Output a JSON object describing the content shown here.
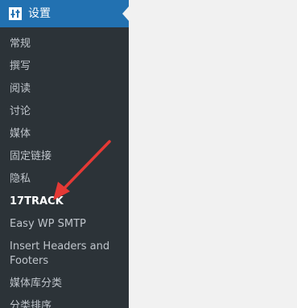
{
  "sidebar": {
    "header": {
      "title": "设置",
      "icon": "settings-sliders-icon"
    },
    "items": [
      {
        "label": "常规",
        "current": false
      },
      {
        "label": "撰写",
        "current": false
      },
      {
        "label": "阅读",
        "current": false
      },
      {
        "label": "讨论",
        "current": false
      },
      {
        "label": "媒体",
        "current": false
      },
      {
        "label": "固定链接",
        "current": false
      },
      {
        "label": "隐私",
        "current": false
      },
      {
        "label": "17TRACK",
        "current": true
      },
      {
        "label": "Easy WP SMTP",
        "current": false
      },
      {
        "label": "Insert Headers and Footers",
        "current": false
      },
      {
        "label": "媒体库分类",
        "current": false
      },
      {
        "label": "分类排序",
        "current": false
      }
    ]
  },
  "colors": {
    "sidebar_bg": "#2c3338",
    "header_bg": "#2271b1",
    "content_bg": "#f1f1f1",
    "annotation_arrow": "#e53935"
  }
}
